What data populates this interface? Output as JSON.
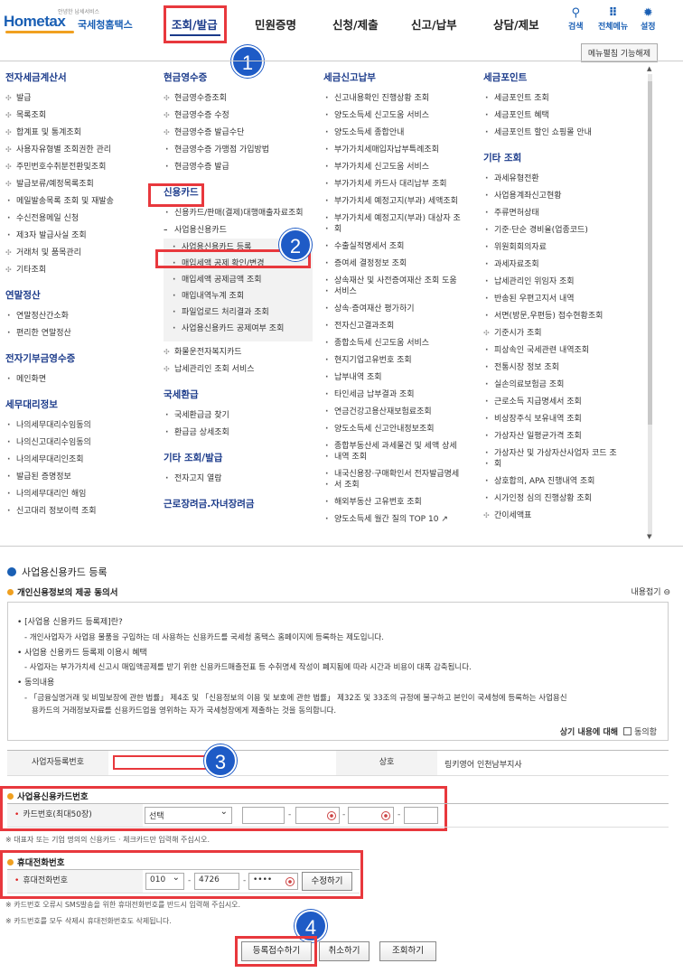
{
  "header": {
    "logo_small": "안녕한 납세서비스",
    "logo_home": "Home",
    "logo_tax": "tax",
    "logo_kr": "국세청홈택스",
    "nav": [
      "조회/발급",
      "민원증명",
      "신청/제출",
      "신고/납부",
      "상담/제보"
    ],
    "icons": [
      {
        "name": "search-icon",
        "label": "검색",
        "glyph": "⚲"
      },
      {
        "name": "grid-menu-icon",
        "label": "전체메뉴",
        "glyph": "⠿"
      },
      {
        "name": "settings-icon",
        "label": "설정",
        "glyph": "✹"
      }
    ],
    "menu_toggle": "메뉴펼침 기능해제"
  },
  "annotations": {
    "b1": "1",
    "b2": "2",
    "b3": "3",
    "b4": "4",
    "accent": "#e8383d",
    "badge_color": "#1e5bc6"
  },
  "menu": {
    "col1": {
      "s1": "전자세금계산서",
      "s1_items": [
        "발급",
        "목록조회",
        "합계표 및 통계조회",
        "사용자유형별 조회권한 관리",
        "주민번호수취분전환및조회",
        "발급보류/예정목록조회",
        "메일발송목록 조회 및 재발송",
        "수신전용메일 신청",
        "제3자 발급사실 조회",
        "거래처 및 품목관리",
        "기타조회"
      ],
      "s2": "연말정산",
      "s2_items": [
        "연말정산간소화",
        "편리한 연말정산"
      ],
      "s3": "전자기부금영수증",
      "s3_items": [
        "메인화면"
      ],
      "s4": "세무대리정보",
      "s4_items": [
        "나의세무대리수임동의",
        "나의신고대리수임동의",
        "나의세무대리인조회",
        "발급된 증명정보",
        "나의세무대리인 해임",
        "신고대리 정보이력 조회"
      ]
    },
    "col2": {
      "s1": "현금영수증",
      "s1_items": [
        "현금영수증조회",
        "현금영수증 수정",
        "현금영수증 발급수단",
        "현금영수증 가맹점 가입방법",
        "현금영수증 발급"
      ],
      "s2": "신용카드",
      "s2_item": "신용카드/판매(결제)대행매출자료조회",
      "s2_group": "사업용신용카드",
      "s2_sub": [
        "사업용신용카드 등록",
        "매입세액 공제 확인/변경",
        "매입세액 공제금액 조회",
        "매입내역누계 조회",
        "파일업로드 처리결과 조회",
        "사업용신용카드 공제여부 조회"
      ],
      "s2_after": [
        "화물운전자복지카드",
        "납세관리인 조회 서비스"
      ],
      "s3": "국세환급",
      "s3_items": [
        "국세환급금 찾기",
        "환급금 상세조회"
      ],
      "s4": "기타 조회/발급",
      "s4_items": [
        "전자고지 열람"
      ],
      "s5": "근로장려금.자녀장려금"
    },
    "col3": {
      "s1": "세금신고납부",
      "items": [
        "신고내용확인 진행상황 조회",
        "양도소득세 신고도움 서비스",
        "양도소득세 종합안내",
        "부가가치세매입자납부특례조회",
        "부가가치세 신고도움 서비스",
        "부가가치세 카드사 대리납부 조회",
        "부가가치세 예정고지(부과) 세액조회",
        "부가가치세 예정고지(부과) 대상자 조",
        "회",
        "수출실적명세서 조회",
        "증여세 결정정보 조회",
        "상속재산 및 사전증여재산 조회 도움",
        "서비스",
        "상속·증여재산 평가하기",
        "전자신고결과조회",
        "종합소득세 신고도움 서비스",
        "현지기업고유번호 조회",
        "납부내역 조회",
        "타인세금 납부결과 조회",
        "연금건강고용산재보험료조회",
        "양도소득세 신고안내정보조회",
        "종합부동산세 과세물건 및 세액 상세",
        "내역 조회",
        "내국신용장·구매확인서 전자발급명세",
        "서 조회",
        "해외부동산 고유번호 조회",
        "양도소득세 월간 질의 TOP 10"
      ]
    },
    "col4": {
      "s1": "세금포인트",
      "s1_items": [
        "세금포인트 조회",
        "세금포인트 혜택",
        "세금포인트 할인 쇼핑몰 안내"
      ],
      "s2": "기타 조회",
      "s2_items": [
        "과세유형전환",
        "사업용계좌신고현황",
        "주류면허상태",
        "기준·단순 경비율(업종코드)",
        "위원회회의자료",
        "과세자료조회",
        "납세관리인 위임자 조회",
        "반송된 우편고지서 내역",
        "서면(방문,우편등) 접수현황조회",
        "기준시가 조회",
        "피상속인 국세관련 내역조회",
        "전통시장 정보 조회",
        "실손의료보험금 조회",
        "근로소득 지급명세서 조회",
        "비상장주식 보유내역 조회",
        "가상자산 일평균가격 조회",
        "가상자산 및 가상자산사업자 코드 조",
        "회",
        "상호합의, APA 진행내역 조회",
        "시가인정 심의 진행상황 조회",
        "간이세액표"
      ]
    }
  },
  "form": {
    "title": "사업용신용카드 등록",
    "consent_title": "개인신용정보의 제공 동의서",
    "collapse": "내용접기",
    "consent": [
      "[사업용 신용카드 등록제]란?",
      "- 개인사업자가 사업용 물품을 구입하는 데 사용하는 신용카드를 국세청 홈택스 홈페이지에 등록하는 제도입니다.",
      "사업용 신용카드 등록제 이용시 혜택",
      "- 사업자는 부가가치세 신고시 매입액공제를 받기 위한 신용카드매출전표 등 수취명세 작성이 폐지됨에 따라 시간과 비용이 대폭 감축됩니다.",
      "동의내용",
      "- 「금융실명거래 및 비밀보장에 관한 법률」 제4조 및 「신용정보의 이용 및 보호에 관한 법률」 제32조 및 33조의 규정에 불구하고 본인이 국세청에 등록하는 사업용신",
      "용카드의   거래정보자료를 신용카드업을 영위하는 자가 국세청장에게 제출하는 것을 동의합니다."
    ],
    "agree_label": "상기 내용에 대해",
    "agree_check": "동의함",
    "bizno_label": "사업자등록번호",
    "bizno_value": "",
    "company_label": "상호",
    "company_value": "링키영어 인천남부지사",
    "card_section": "사업용신용카드번호",
    "card_label": "카드번호(최대50장)",
    "card_select": "선택",
    "card_note": "※ 대표자 또는 기업 명의의 신용카드 · 체크카드만 입력해 주십시오.",
    "phone_section": "휴대전화번호",
    "phone_label": "휴대전화번호",
    "phone_prefix": "010",
    "phone_mid": "4726",
    "phone_last": "••••",
    "phone_edit": "수정하기",
    "note1": "※ 카드번호 오류시 SMS발송을 위한 휴대전화번호를 반드시 입력해 주십시오.",
    "note2": "※ 카드번호를 모두 삭제시 휴대전화번호도 삭제됩니다.",
    "btn_submit": "등록접수하기",
    "btn_cancel": "취소하기",
    "btn_search": "조회하기"
  }
}
